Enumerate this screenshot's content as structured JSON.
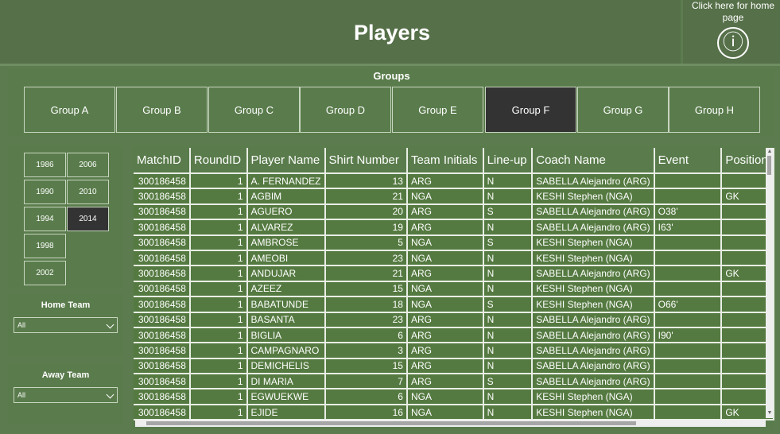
{
  "header": {
    "title": "Players",
    "home_text": "Click here for home page",
    "info_icon": "ⓘ"
  },
  "groups": {
    "title": "Groups",
    "items": [
      "Group A",
      "Group B",
      "Group C",
      "Group D",
      "Group E",
      "Group F",
      "Group G",
      "Group H"
    ],
    "selected": "Group F"
  },
  "years": {
    "items": [
      "1986",
      "2006",
      "1990",
      "2010",
      "1994",
      "2014",
      "1998",
      "2002"
    ],
    "selected": "2014"
  },
  "home_team": {
    "title": "Home Team",
    "value": "All"
  },
  "away_team": {
    "title": "Away Team",
    "value": "All"
  },
  "table": {
    "columns": [
      "MatchID",
      "RoundID",
      "Player Name",
      "Shirt Number",
      "Team Initials",
      "Line-up",
      "Coach Name",
      "Event",
      "Position"
    ],
    "rows": [
      [
        "300186458",
        "1",
        "A. FERNANDEZ",
        "13",
        "ARG",
        "N",
        "SABELLA Alejandro (ARG)",
        "",
        ""
      ],
      [
        "300186458",
        "1",
        "AGBIM",
        "21",
        "NGA",
        "N",
        "KESHI Stephen (NGA)",
        "",
        "GK"
      ],
      [
        "300186458",
        "1",
        "AGUERO",
        "20",
        "ARG",
        "S",
        "SABELLA Alejandro (ARG)",
        "O38'",
        ""
      ],
      [
        "300186458",
        "1",
        "ALVAREZ",
        "19",
        "ARG",
        "N",
        "SABELLA Alejandro (ARG)",
        "I63'",
        ""
      ],
      [
        "300186458",
        "1",
        "AMBROSE",
        "5",
        "NGA",
        "S",
        "KESHI Stephen (NGA)",
        "",
        ""
      ],
      [
        "300186458",
        "1",
        "AMEOBI",
        "23",
        "NGA",
        "N",
        "KESHI Stephen (NGA)",
        "",
        ""
      ],
      [
        "300186458",
        "1",
        "ANDUJAR",
        "21",
        "ARG",
        "N",
        "SABELLA Alejandro (ARG)",
        "",
        "GK"
      ],
      [
        "300186458",
        "1",
        "AZEEZ",
        "15",
        "NGA",
        "N",
        "KESHI Stephen (NGA)",
        "",
        ""
      ],
      [
        "300186458",
        "1",
        "BABATUNDE",
        "18",
        "NGA",
        "S",
        "KESHI Stephen (NGA)",
        "O66'",
        ""
      ],
      [
        "300186458",
        "1",
        "BASANTA",
        "23",
        "ARG",
        "N",
        "SABELLA Alejandro (ARG)",
        "",
        ""
      ],
      [
        "300186458",
        "1",
        "BIGLIA",
        "6",
        "ARG",
        "N",
        "SABELLA Alejandro (ARG)",
        "I90'",
        ""
      ],
      [
        "300186458",
        "1",
        "CAMPAGNARO",
        "3",
        "ARG",
        "N",
        "SABELLA Alejandro (ARG)",
        "",
        ""
      ],
      [
        "300186458",
        "1",
        "DEMICHELIS",
        "15",
        "ARG",
        "N",
        "SABELLA Alejandro (ARG)",
        "",
        ""
      ],
      [
        "300186458",
        "1",
        "DI MARIA",
        "7",
        "ARG",
        "S",
        "SABELLA Alejandro (ARG)",
        "",
        ""
      ],
      [
        "300186458",
        "1",
        "EGWUEKWE",
        "6",
        "NGA",
        "N",
        "KESHI Stephen (NGA)",
        "",
        ""
      ],
      [
        "300186458",
        "1",
        "EJIDE",
        "16",
        "NGA",
        "N",
        "KESHI Stephen (NGA)",
        "",
        "GK"
      ]
    ]
  }
}
